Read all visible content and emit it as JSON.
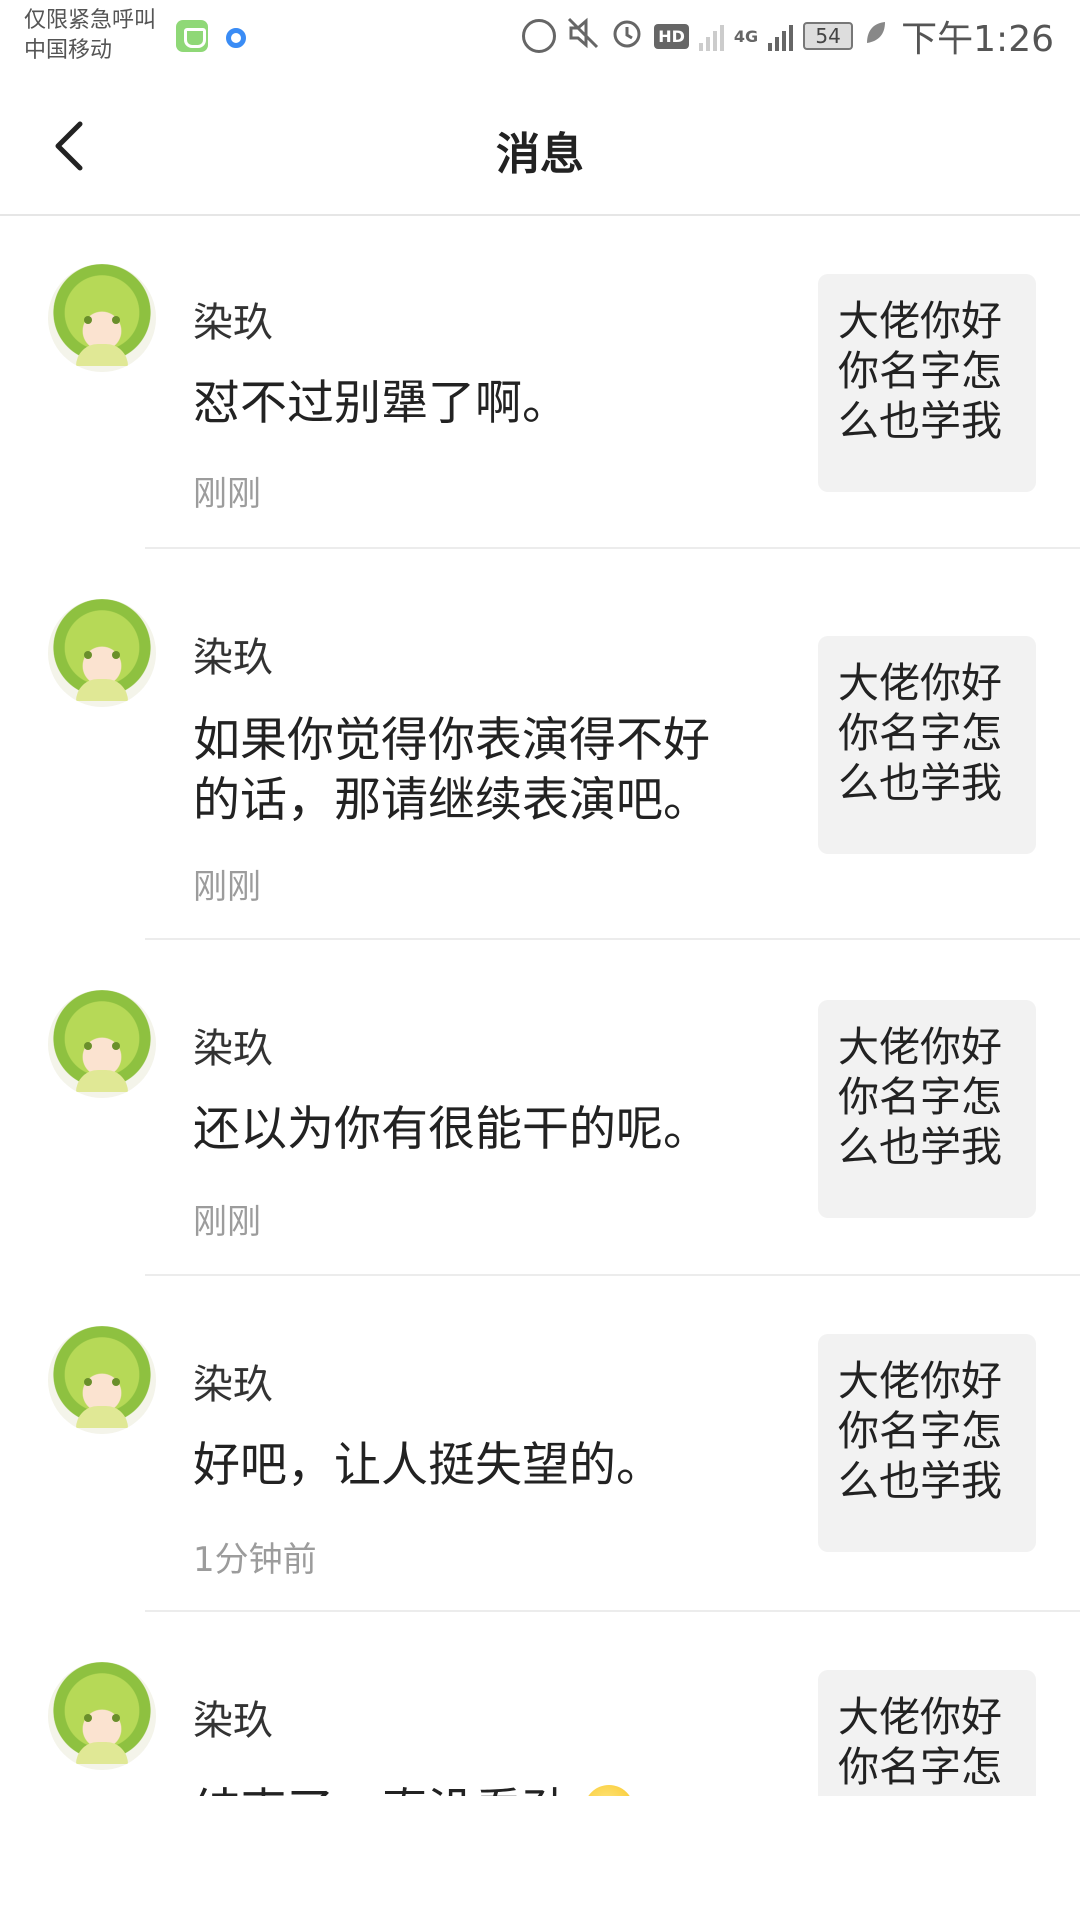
{
  "status_bar": {
    "carrier_line1": "仅限紧急呼叫",
    "carrier_line2": "中国移动",
    "hd": "HD",
    "network": "4G",
    "battery": "54",
    "time": "下午1:26"
  },
  "header": {
    "title": "消息"
  },
  "messages": [
    {
      "sender": "染玖",
      "text": "怼不过别犟了啊。",
      "time": "刚刚",
      "quote": "大佬你好你名字怎么也学我"
    },
    {
      "sender": "染玖",
      "text": "如果你觉得你表演得不好的话，那请继续表演吧。",
      "time": "刚刚",
      "quote": "大佬你好你名字怎么也学我"
    },
    {
      "sender": "染玖",
      "text": "还以为你有很能干的呢。",
      "time": "刚刚",
      "quote": "大佬你好你名字怎么也学我"
    },
    {
      "sender": "染玖",
      "text": "好吧，让人挺失望的。",
      "time": "1分钟前",
      "quote": "大佬你好你名字怎么也学我"
    },
    {
      "sender": "染玖",
      "text": "结束了，真没看劲",
      "time": "",
      "quote": "大佬你好你名字怎么也学我"
    }
  ]
}
